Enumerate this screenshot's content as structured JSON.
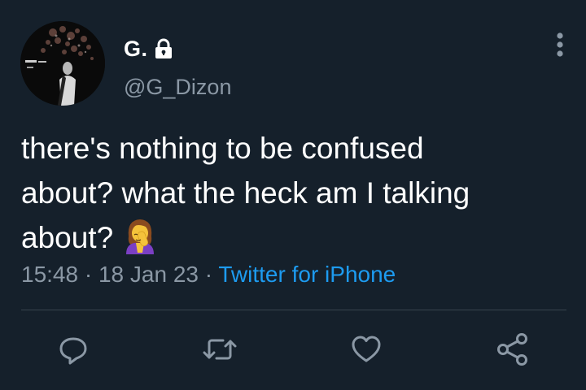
{
  "author": {
    "display_name": "G.",
    "handle": "@G_Dizon",
    "protected_icon": "lock-icon",
    "avatar_icon": "avatar"
  },
  "menu": {
    "icon": "more-vertical-icon"
  },
  "tweet": {
    "text_line1": "there's nothing to be confused",
    "text_line2": "about? what the heck am I talking",
    "text_line3": "about?",
    "emoji": "🤦‍♀️",
    "time": "15:48",
    "separator": " · ",
    "date": "18 Jan 23",
    "source": "Twitter for iPhone"
  },
  "actions": [
    {
      "name": "reply",
      "icon": "reply-icon"
    },
    {
      "name": "retweet",
      "icon": "retweet-icon"
    },
    {
      "name": "like",
      "icon": "heart-icon"
    },
    {
      "name": "share",
      "icon": "share-icon"
    }
  ],
  "colors": {
    "background": "#15202b",
    "text_primary": "#ffffff",
    "text_secondary": "#8b98a5",
    "link": "#1d9bf0",
    "divider": "#38444d",
    "emoji_hair": "#8a4b1f",
    "emoji_shirt": "#7b3fc4"
  }
}
